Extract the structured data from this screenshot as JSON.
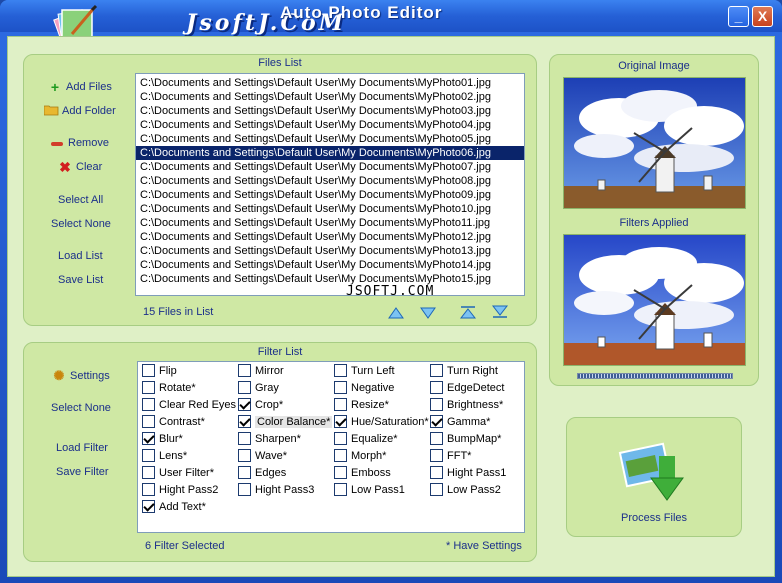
{
  "window": {
    "title": "Auto Photo Editor",
    "brand": "JsoftJ.CoM",
    "min_label": "_",
    "close_label": "X"
  },
  "files_panel": {
    "title": "Files List",
    "buttons": {
      "add_files": "Add Files",
      "add_folder": "Add Folder",
      "remove": "Remove",
      "clear": "Clear",
      "select_all": "Select All",
      "select_none": "Select None",
      "load_list": "Load List",
      "save_list": "Save List"
    },
    "files": [
      "C:\\Documents and Settings\\Default User\\My Documents\\MyPhoto01.jpg",
      "C:\\Documents and Settings\\Default User\\My Documents\\MyPhoto02.jpg",
      "C:\\Documents and Settings\\Default User\\My Documents\\MyPhoto03.jpg",
      "C:\\Documents and Settings\\Default User\\My Documents\\MyPhoto04.jpg",
      "C:\\Documents and Settings\\Default User\\My Documents\\MyPhoto05.jpg",
      "C:\\Documents and Settings\\Default User\\My Documents\\MyPhoto06.jpg",
      "C:\\Documents and Settings\\Default User\\My Documents\\MyPhoto07.jpg",
      "C:\\Documents and Settings\\Default User\\My Documents\\MyPhoto08.jpg",
      "C:\\Documents and Settings\\Default User\\My Documents\\MyPhoto09.jpg",
      "C:\\Documents and Settings\\Default User\\My Documents\\MyPhoto10.jpg",
      "C:\\Documents and Settings\\Default User\\My Documents\\MyPhoto11.jpg",
      "C:\\Documents and Settings\\Default User\\My Documents\\MyPhoto12.jpg",
      "C:\\Documents and Settings\\Default User\\My Documents\\MyPhoto13.jpg",
      "C:\\Documents and Settings\\Default User\\My Documents\\MyPhoto14.jpg",
      "C:\\Documents and Settings\\Default User\\My Documents\\MyPhoto15.jpg"
    ],
    "selected_index": 5,
    "status": "15 Files in List",
    "watermark": "JSOFTJ.COM"
  },
  "filter_panel": {
    "title": "Filter List",
    "buttons": {
      "settings": "Settings",
      "select_none": "Select None",
      "load_filter": "Load Filter",
      "save_filter": "Save Filter"
    },
    "filters": [
      {
        "label": "Flip",
        "checked": false
      },
      {
        "label": "Mirror",
        "checked": false
      },
      {
        "label": "Turn Left",
        "checked": false
      },
      {
        "label": "Turn Right",
        "checked": false
      },
      {
        "label": "Rotate*",
        "checked": false
      },
      {
        "label": "Gray",
        "checked": false
      },
      {
        "label": "Negative",
        "checked": false
      },
      {
        "label": "EdgeDetect",
        "checked": false
      },
      {
        "label": "Clear Red Eyes",
        "checked": false
      },
      {
        "label": "Crop*",
        "checked": true
      },
      {
        "label": "Resize*",
        "checked": false
      },
      {
        "label": "Brightness*",
        "checked": false
      },
      {
        "label": "Contrast*",
        "checked": false
      },
      {
        "label": "Color Balance*",
        "checked": true,
        "highlight": true
      },
      {
        "label": "Hue/Saturation*",
        "checked": true
      },
      {
        "label": "Gamma*",
        "checked": true
      },
      {
        "label": "Blur*",
        "checked": true
      },
      {
        "label": "Sharpen*",
        "checked": false
      },
      {
        "label": "Equalize*",
        "checked": false
      },
      {
        "label": "BumpMap*",
        "checked": false
      },
      {
        "label": "Lens*",
        "checked": false
      },
      {
        "label": "Wave*",
        "checked": false
      },
      {
        "label": "Morph*",
        "checked": false
      },
      {
        "label": "FFT*",
        "checked": false
      },
      {
        "label": "User Filter*",
        "checked": false
      },
      {
        "label": "Edges",
        "checked": false
      },
      {
        "label": "Emboss",
        "checked": false
      },
      {
        "label": "Hight Pass1",
        "checked": false
      },
      {
        "label": "Hight Pass2",
        "checked": false
      },
      {
        "label": "Hight Pass3",
        "checked": false
      },
      {
        "label": "Low Pass1",
        "checked": false
      },
      {
        "label": "Low Pass2",
        "checked": false
      },
      {
        "label": "Add Text*",
        "checked": true
      }
    ],
    "status": "6 Filter Selected",
    "note": "* Have Settings"
  },
  "preview": {
    "original_title": "Original Image",
    "filtered_title": "Filters Applied"
  },
  "process": {
    "label": "Process Files"
  },
  "colors": {
    "panel": "#cfe8a4",
    "client": "#dff0c6",
    "title_blue": "#2560d6",
    "label_text": "#1b2f8a",
    "selection": "#0a246a"
  }
}
